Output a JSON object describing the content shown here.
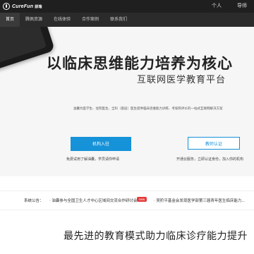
{
  "header": {
    "logo_text": "CureFun",
    "logo_badge": "訓瑞",
    "links": [
      "个人",
      "导师"
    ]
  },
  "nav": {
    "items": [
      "首页",
      "腾佩资源",
      "在线体验",
      "合作案例",
      "联系我们"
    ]
  },
  "hero": {
    "title": "以临床思维能力培养为核心",
    "subtitle": "互联网医学教育平台",
    "description": "油囊为医学生、住院医生、全科（基层）医生提供临床思维能力训练、考核和评价的一站式互联网解决方案",
    "primary_button": "机构入驻",
    "secondary_button": "教师认证",
    "hint_left": "免费试用了解油囊，学员请你申请",
    "hint_right": "开通云服务，立即认证身份，加入你的机构"
  },
  "news": {
    "label": "系统公告：",
    "item1": "· 油囊参与全国卫生人才中心区域间交流合作研讨会",
    "tag": "new",
    "item2": "· 吴阶平基金会发现医学部第三届青年医生临床能力..."
  },
  "section": {
    "title": "最先进的教育模式助力临床诊疗能力提升"
  },
  "colors": {
    "accent": "#1592d8",
    "topbar": "#1f1f1f",
    "navbar": "#2b2b2b",
    "tag": "#e23b3b"
  }
}
